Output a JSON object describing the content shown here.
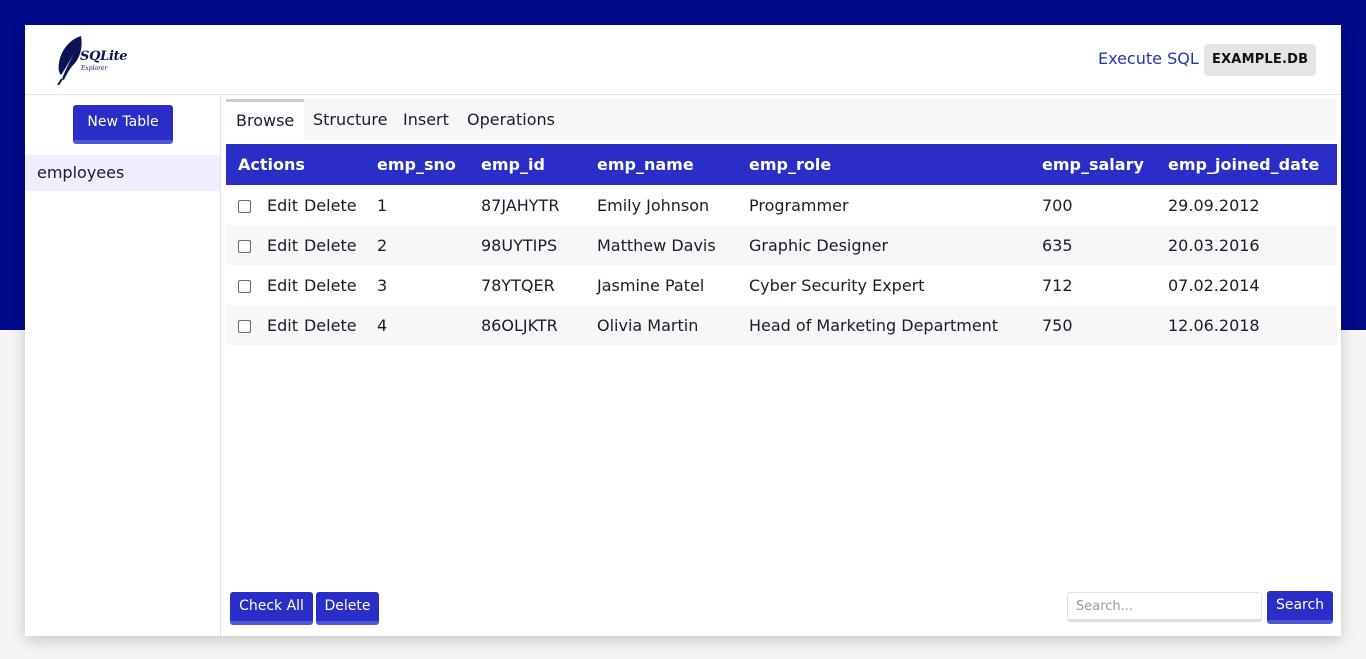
{
  "header": {
    "logo_text": "SQLite",
    "logo_sub": "Explorer",
    "execute_sql": "Execute SQL",
    "db_name": "EXAMPLE.DB"
  },
  "sidebar": {
    "new_table": "New Table",
    "tables": [
      "employees"
    ]
  },
  "tabs": [
    "Browse",
    "Structure",
    "Insert",
    "Operations"
  ],
  "active_tab": "Browse",
  "table": {
    "columns": [
      "Actions",
      "emp_sno",
      "emp_id",
      "emp_name",
      "emp_role",
      "emp_salary",
      "emp_joined_date"
    ],
    "edit_label": "Edit",
    "delete_label": "Delete",
    "rows": [
      [
        "1",
        "87JAHYTR",
        "Emily Johnson",
        "Programmer",
        "700",
        "29.09.2012"
      ],
      [
        "2",
        "98UYTIPS",
        "Matthew Davis",
        "Graphic Designer",
        "635",
        "20.03.2016"
      ],
      [
        "3",
        "78YTQER",
        "Jasmine Patel",
        "Cyber Security Expert",
        "712",
        "07.02.2014"
      ],
      [
        "4",
        "86OLJKTR",
        "Olivia Martin",
        "Head of Marketing Department",
        "750",
        "12.06.2018"
      ]
    ]
  },
  "footer": {
    "check_all": "Check All",
    "delete": "Delete",
    "search_placeholder": "Search...",
    "search": "Search"
  },
  "colors": {
    "accent": "#2a2ec7",
    "band": "#000a8a"
  }
}
